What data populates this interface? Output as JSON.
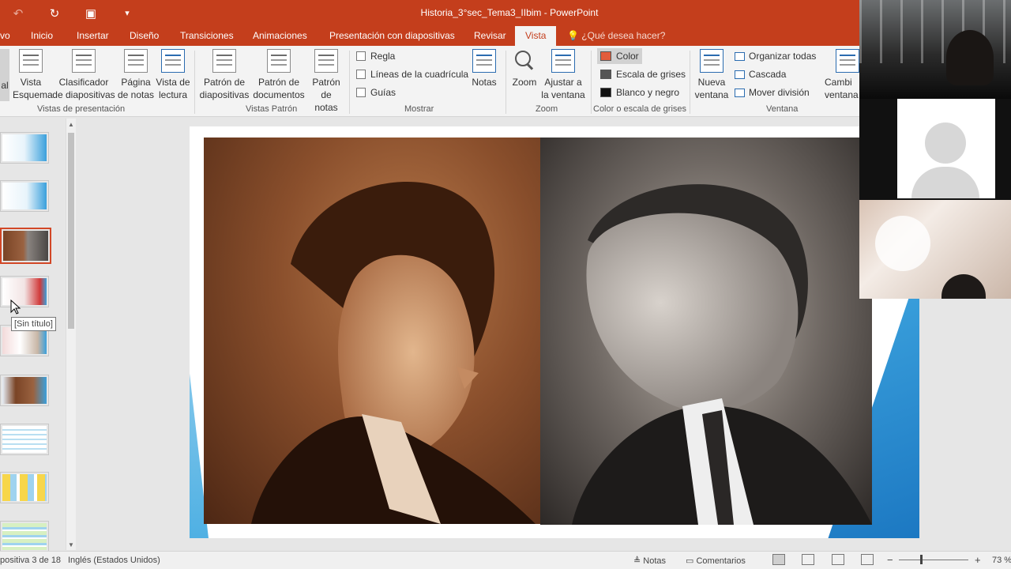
{
  "title_bar": {
    "document_title": "Historia_3°sec_Tema3_IIbim - PowerPoint",
    "qat": [
      {
        "name": "undo-icon",
        "glyph": "↶"
      },
      {
        "name": "redo-icon",
        "glyph": "↻"
      },
      {
        "name": "start-slideshow-icon",
        "glyph": "▣"
      },
      {
        "name": "customize-qat-icon",
        "glyph": "▾"
      }
    ]
  },
  "tabs": {
    "items": [
      "vo",
      "Inicio",
      "Insertar",
      "Diseño",
      "Transiciones",
      "Animaciones",
      "Presentación con diapositivas",
      "Revisar",
      "Vista"
    ],
    "active": "Vista",
    "tell_me": "¿Qué desea hacer?"
  },
  "ribbon": {
    "presentation_views": {
      "label": "Vistas de presentación",
      "buttons": [
        "al",
        "Vista\nEsquema",
        "Clasificador\nde diapositivas",
        "Página\nde notas",
        "Vista de\nlectura"
      ]
    },
    "master_views": {
      "label": "Vistas Patrón",
      "buttons": [
        "Patrón de\ndiapositivas",
        "Patrón de\ndocumentos",
        "Patrón\nde notas"
      ]
    },
    "show": {
      "label": "Mostrar",
      "checks": [
        "Regla",
        "Líneas de la cuadrícula",
        "Guías"
      ],
      "notes_button": "Notas"
    },
    "zoom": {
      "label": "Zoom",
      "buttons": [
        "Zoom",
        "Ajustar a\nla ventana"
      ]
    },
    "color": {
      "label": "Color o escala de grises",
      "options": [
        "Color",
        "Escala de grises",
        "Blanco y negro"
      ],
      "selected": "Color",
      "swatch_colors": [
        "#e25c3c",
        "#555555",
        "#111111"
      ]
    },
    "window": {
      "label": "Ventana",
      "new_window": "Nueva\nventana",
      "items": [
        "Organizar todas",
        "Cascada",
        "Mover división"
      ],
      "switch": "Cambi\nventana"
    }
  },
  "slide_panel": {
    "tooltip": "[Sin título]",
    "selected_index": 3
  },
  "status_bar": {
    "slide_info": "positiva 3 de 18",
    "language": "Inglés (Estados Unidos)",
    "notes": "Notas",
    "comments": "Comentarios",
    "zoom_minus": "−",
    "zoom_plus": "+",
    "zoom_level": "73 %"
  },
  "colors": {
    "accent": "#c43e1c",
    "ribbon_bg": "#f3f3f3",
    "workspace_bg": "#e6e6e6"
  }
}
